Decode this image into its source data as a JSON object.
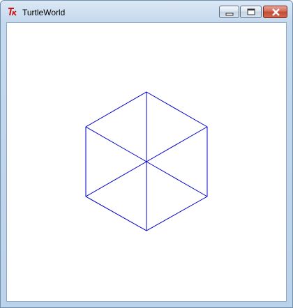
{
  "window": {
    "title": "TurtleWorld",
    "app_icon": "tk-feather-icon",
    "controls": [
      {
        "name": "minimize-button",
        "icon": "minimize-icon"
      },
      {
        "name": "maximize-button",
        "icon": "maximize-icon"
      },
      {
        "name": "close-button",
        "icon": "close-icon"
      }
    ]
  },
  "canvas": {
    "background": "#ffffff",
    "stroke_color": "#0000cc",
    "shape": "hexagon-with-spokes"
  },
  "colors": {
    "titlebar": "#c5d9ee",
    "close_button": "#c24a33"
  }
}
